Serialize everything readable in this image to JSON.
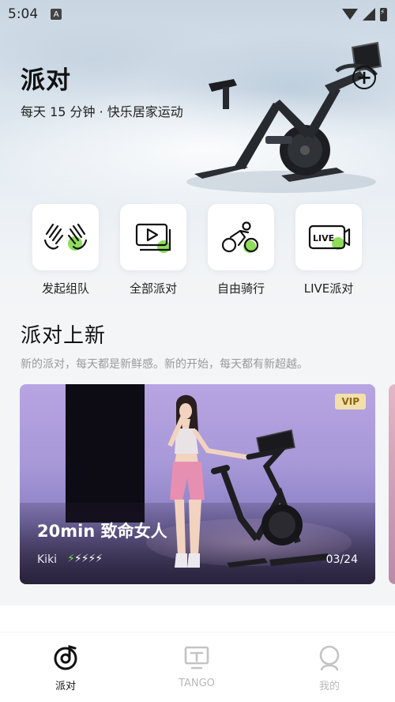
{
  "status_bar": {
    "time": "5:04",
    "notification_icon": "A"
  },
  "header": {
    "title": "派对",
    "subtitle": "每天 15 分钟 · 快乐居家运动"
  },
  "categories": [
    {
      "label": "发起组队",
      "icon": "hands-icon"
    },
    {
      "label": "全部派对",
      "icon": "play-stack-icon"
    },
    {
      "label": "自由骑行",
      "icon": "cyclist-icon"
    },
    {
      "label": "LIVE派对",
      "icon": "live-icon"
    }
  ],
  "live_icon_text": "LIVE",
  "section": {
    "title": "派对上新",
    "subtitle": "新的派对，每天都是新鲜感。新的开始，每天都有新超越。"
  },
  "featured_card": {
    "badge": "VIP",
    "title": "20min 致命女人",
    "coach": "Kiki",
    "intensity": 1,
    "intensity_max": 5,
    "date": "03/24"
  },
  "tabs": [
    {
      "label": "派对",
      "icon": "party-icon",
      "active": true
    },
    {
      "label": "TANGO",
      "icon": "tango-icon",
      "active": false
    },
    {
      "label": "我的",
      "icon": "profile-icon",
      "active": false
    }
  ],
  "colors": {
    "accent": "#7fd94e",
    "vip_bg": "#f3dfaa",
    "vip_text": "#8a6518"
  }
}
